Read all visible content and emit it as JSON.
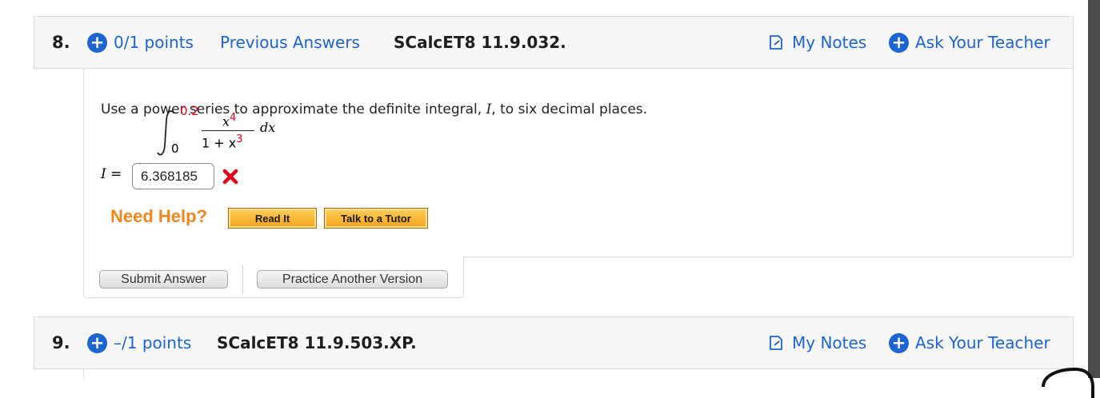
{
  "q8": {
    "number": "8.",
    "points": "0/1 points",
    "previous_answers": "Previous Answers",
    "code": "SCalcET8 11.9.032.",
    "my_notes": "My Notes",
    "ask_teacher": "Ask Your Teacher",
    "prompt_before": "Use a power series to approximate the definite integral, ",
    "prompt_var": "I",
    "prompt_after": ", to six decimal places.",
    "integral": {
      "upper": "0.2",
      "lower": "0",
      "num_base": "x",
      "num_exp": "4",
      "den_base": "1 + x",
      "den_exp": "3",
      "dx": "dx"
    },
    "answer_label_var": "I",
    "answer_label_eq": " =",
    "answer_value": "6.368185",
    "need_help": "Need Help?",
    "read_it": "Read It",
    "talk_tutor": "Talk to a Tutor",
    "submit": "Submit Answer",
    "practice": "Practice Another Version"
  },
  "q9": {
    "number": "9.",
    "points": "–/1 points",
    "code": "SCalcET8 11.9.503.XP.",
    "my_notes": "My Notes",
    "ask_teacher": "Ask Your Teacher"
  },
  "icons": {
    "plus": "plus-circle-icon",
    "notes": "notes-icon",
    "incorrect": "x-mark-icon"
  },
  "colors": {
    "link_blue": "#1c64d1",
    "incorrect_red": "#e3001b",
    "help_orange": "#f0861e",
    "header_bg": "#f7f7f7"
  }
}
